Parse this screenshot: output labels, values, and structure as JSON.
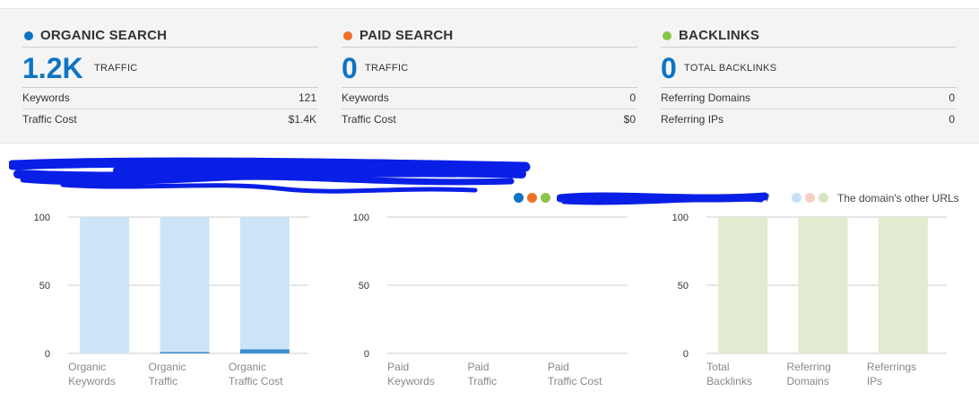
{
  "summary": {
    "organic": {
      "title": "ORGANIC SEARCH",
      "value": "1.2K",
      "value_label": "TRAFFIC",
      "dot_color": "#0c74c5",
      "rows": [
        {
          "label": "Keywords",
          "value": "121"
        },
        {
          "label": "Traffic Cost",
          "value": "$1.4K"
        }
      ]
    },
    "paid": {
      "title": "PAID SEARCH",
      "value": "0",
      "value_label": "TRAFFIC",
      "dot_color": "#f07029",
      "rows": [
        {
          "label": "Keywords",
          "value": "0"
        },
        {
          "label": "Traffic Cost",
          "value": "$0"
        }
      ]
    },
    "backlinks": {
      "title": "BACKLINKS",
      "value": "0",
      "value_label": "TOTAL BACKLINKS",
      "dot_color": "#8bc34a",
      "rows": [
        {
          "label": "Referring Domains",
          "value": "0"
        },
        {
          "label": "Referring IPs",
          "value": "0"
        }
      ]
    }
  },
  "legend": {
    "current_colors": [
      "#0c74c5",
      "#f07029",
      "#8bc34a"
    ],
    "other_colors": [
      "#c8e0f6",
      "#f4d0c3",
      "#d6e6c4"
    ],
    "other_label": "The domain's other URLs",
    "redacted_slash": "/"
  },
  "colors": {
    "organic_base": "#cde4f7",
    "organic_fill": "#3c8fd0",
    "backlinks_base": "#e0ebd0",
    "gridline": "#cccccc",
    "redaction": "#0a1fe6"
  },
  "chart_data": [
    {
      "type": "bar",
      "categories": [
        [
          "Organic",
          "Keywords"
        ],
        [
          "Organic",
          "Traffic"
        ],
        [
          "Organic",
          "Traffic Cost"
        ]
      ],
      "series": [
        {
          "values": [
            0,
            1,
            3
          ]
        },
        {
          "name": "The domain's other URLs",
          "values": [
            100,
            99,
            97
          ]
        }
      ],
      "ylim": [
        0,
        100
      ],
      "yticks": [
        "0",
        "50",
        "100"
      ],
      "stacked": true
    },
    {
      "type": "bar",
      "categories": [
        [
          "Paid",
          "Keywords"
        ],
        [
          "Paid",
          "Traffic"
        ],
        [
          "Paid",
          "Traffic Cost"
        ]
      ],
      "series": [
        {
          "values": [
            0,
            0,
            0
          ]
        },
        {
          "name": "The domain's other URLs",
          "values": [
            0,
            0,
            0
          ]
        }
      ],
      "ylim": [
        0,
        100
      ],
      "yticks": [
        "0",
        "50",
        "100"
      ],
      "stacked": true
    },
    {
      "type": "bar",
      "categories": [
        [
          "Total",
          "Backlinks"
        ],
        [
          "Referring",
          "Domains"
        ],
        [
          "Referrings",
          "IPs"
        ]
      ],
      "series": [
        {
          "values": [
            0,
            0,
            0
          ]
        },
        {
          "name": "The domain's other URLs",
          "values": [
            100,
            100,
            100
          ]
        }
      ],
      "ylim": [
        0,
        100
      ],
      "yticks": [
        "0",
        "50",
        "100"
      ],
      "stacked": true
    }
  ]
}
